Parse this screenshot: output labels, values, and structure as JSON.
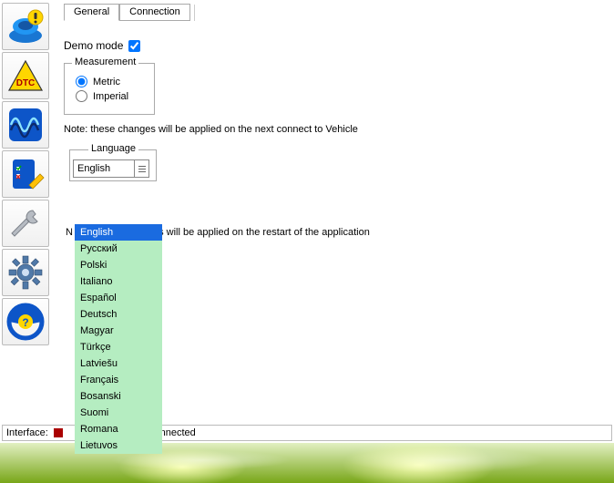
{
  "sidebar": {
    "items": [
      {
        "name": "car-info-icon"
      },
      {
        "name": "dtc-icon"
      },
      {
        "name": "oscilloscope-icon"
      },
      {
        "name": "checklist-icon"
      },
      {
        "name": "wrench-icon"
      },
      {
        "name": "gear-icon"
      },
      {
        "name": "steering-help-icon"
      }
    ]
  },
  "tabs": {
    "general": "General",
    "connection": "Connection"
  },
  "demo": {
    "label": "Demo mode",
    "checked": true
  },
  "measurement": {
    "legend": "Measurement",
    "metric": "Metric",
    "imperial": "Imperial",
    "selected": "metric"
  },
  "note_vehicle": "Note: these changes will be applied on the next connect to Vehicle",
  "language": {
    "legend": "Language",
    "selected": "English",
    "options": [
      "English",
      "Русский",
      "Polski",
      "Italiano",
      "Español",
      "Deutsch",
      "Magyar",
      "Türkçe",
      "Latviešu",
      "Français",
      "Bosanski",
      "Suomi",
      "Romana",
      "Lietuvos"
    ]
  },
  "note_restart_left": "N",
  "note_restart_right": "es will be applied on the restart of the application",
  "status": {
    "label": "Interface:",
    "text": "t connected",
    "led_color": "#a00000"
  }
}
